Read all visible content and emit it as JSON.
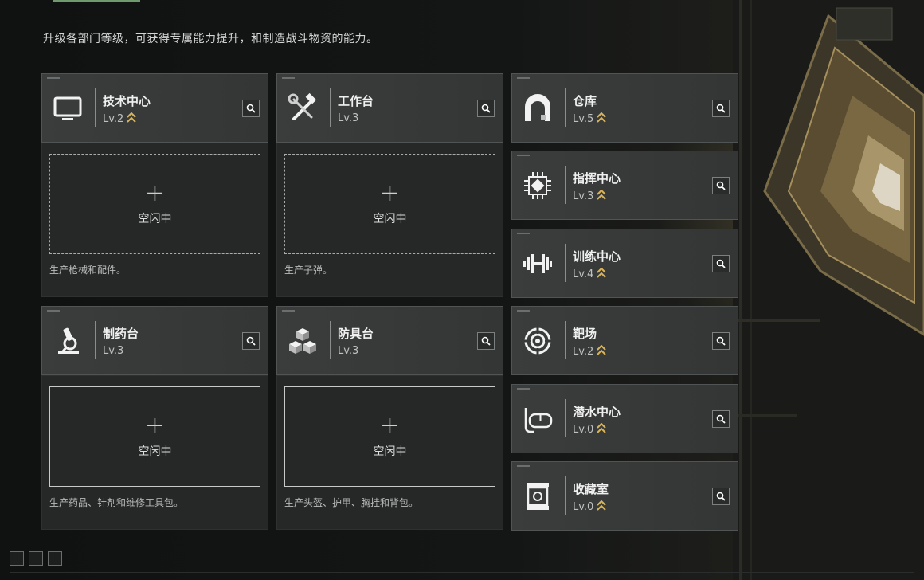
{
  "header": {
    "intro": "升级各部门等级，可获得专属能力提升，和制造战斗物资的能力。"
  },
  "colors": {
    "accent_gold": "#d9b45a",
    "card_bg": "#3a3c3c",
    "panel_bg": "#262828"
  },
  "departments": [
    {
      "id": "tech-center",
      "name": "技术中心",
      "level": "Lv.2",
      "icon": "monitor-icon",
      "idle": "空闲中",
      "description": "生产枪械和配件。"
    },
    {
      "id": "workbench",
      "name": "工作台",
      "level": "Lv.3",
      "icon": "hammer-wrench-icon",
      "idle": "空闲中",
      "description": "生产子弹。"
    },
    {
      "id": "pharmacy",
      "name": "制药台",
      "level": "Lv.3",
      "icon": "microscope-icon",
      "idle": "空闲中",
      "description": "生产药品、针剂和维修工具包。"
    },
    {
      "id": "armor-bench",
      "name": "防具台",
      "level": "Lv.3",
      "icon": "cubes-icon",
      "idle": "空闲中",
      "description": "生产头盔、护甲、胸挂和背包。"
    }
  ],
  "facilities": [
    {
      "id": "warehouse",
      "name": "仓库",
      "level": "Lv.5",
      "icon": "warehouse-icon"
    },
    {
      "id": "command-center",
      "name": "指挥中心",
      "level": "Lv.3",
      "icon": "chip-icon"
    },
    {
      "id": "training-center",
      "name": "训练中心",
      "level": "Lv.4",
      "icon": "dumbbell-icon"
    },
    {
      "id": "shooting-range",
      "name": "靶场",
      "level": "Lv.2",
      "icon": "target-icon"
    },
    {
      "id": "diving-center",
      "name": "潜水中心",
      "level": "Lv.0",
      "icon": "diving-mask-icon"
    },
    {
      "id": "collection-room",
      "name": "收藏室",
      "level": "Lv.0",
      "icon": "display-case-icon"
    }
  ]
}
